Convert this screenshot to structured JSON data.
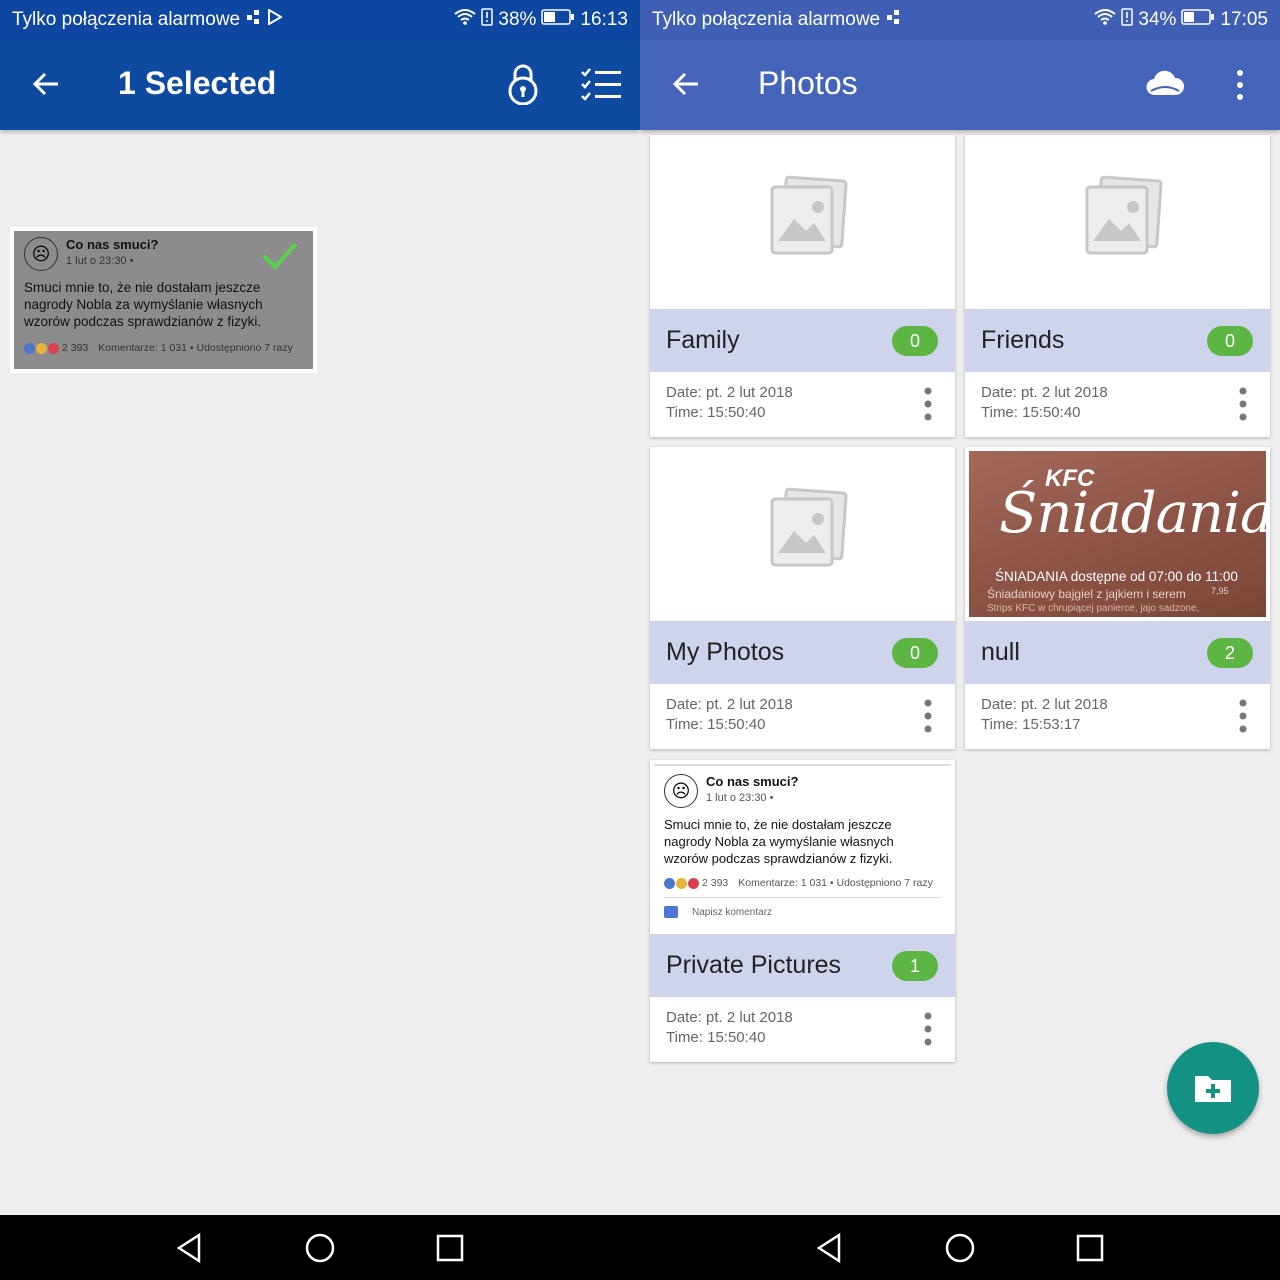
{
  "left": {
    "status": {
      "carrier": "Tylko połączenia alarmowe",
      "battery": "38%",
      "time": "16:13"
    },
    "appbar": {
      "title": "1 Selected"
    },
    "selected_item": {
      "post_title": "Co nas smuci?",
      "post_date": "1 lut o 23:30 •",
      "post_body": "Smuci mnie to, że nie dostałam jeszcze nagrody Nobla za wymyślanie własnych wzorów podczas sprawdzianów z fizyki.",
      "reactions": "2 393",
      "stats": "Komentarze: 1 031 • Udostępniono 7 razy"
    }
  },
  "right": {
    "status": {
      "carrier": "Tylko połączenia alarmowe",
      "battery": "34%",
      "time": "17:05"
    },
    "appbar": {
      "title": "Photos"
    },
    "albums": [
      {
        "name": "Family",
        "count": "0",
        "date": "Date: pt. 2 lut 2018",
        "time": "Time:  15:50:40"
      },
      {
        "name": "Friends",
        "count": "0",
        "date": "Date: pt. 2 lut 2018",
        "time": "Time:  15:50:40"
      },
      {
        "name": "My Photos",
        "count": "0",
        "date": "Date: pt. 2 lut 2018",
        "time": "Time:  15:50:40"
      },
      {
        "name": "null",
        "count": "2",
        "date": "Date: pt. 2 lut 2018",
        "time": "Time:  15:53:17"
      },
      {
        "name": "Private Pictures",
        "count": "1",
        "date": "Date: pt. 2 lut 2018",
        "time": "Time:  15:50:40"
      }
    ],
    "kfc_thumb": {
      "logo": "KFC",
      "script": "Śniadania",
      "line1": "ŚNIADANIA dostępne od 07:00 do 11:00",
      "line2": "Śniadaniowy bajgiel z jajkiem i serem",
      "line3": "Strips KFC w chrupiącej panierce, jajo sadzone,",
      "price": "7,95"
    },
    "private_thumb": {
      "post_title": "Co nas smuci?",
      "post_date": "1 lut o 23:30 •",
      "post_body": "Smuci mnie to, że nie dostałam jeszcze nagrody Nobla za wymyślanie własnych wzorów podczas sprawdzianów z fizyki.",
      "reactions": "2 393",
      "stats": "Komentarze: 1 031 • Udostępniono 7 razy",
      "comment_placeholder": "Napisz komentarz"
    }
  },
  "colors": {
    "left_appbar": "#0d4aa0",
    "right_appbar": "#4464b9",
    "namebar": "#cdd4ec",
    "count_badge": "#5db543",
    "fab": "#139283"
  },
  "icons": [
    "back-arrow-icon",
    "lock-icon",
    "checklist-icon",
    "cloud-icon",
    "overflow-menu-icon",
    "image-placeholder-icon",
    "more-vert-icon",
    "add-folder-icon",
    "checkmark-icon",
    "nav-back-icon",
    "nav-home-icon",
    "nav-recents-icon",
    "wifi-icon",
    "battery-icon"
  ]
}
